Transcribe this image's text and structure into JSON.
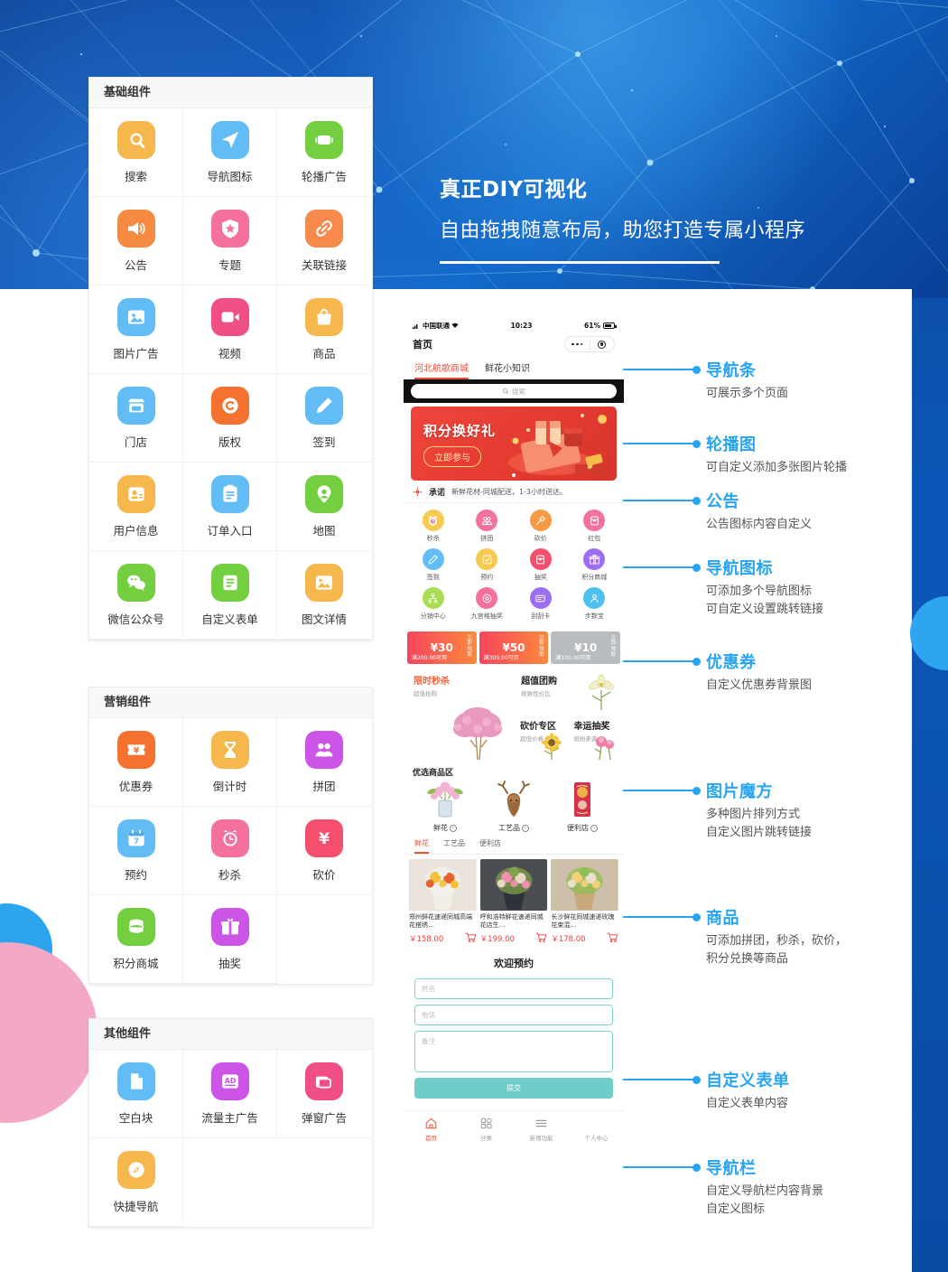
{
  "headline": {
    "line1": "真正DIY可视化",
    "line2": "自由拖拽随意布局，助您打造专属小程序"
  },
  "panels": [
    {
      "title": "基础组件",
      "items": [
        {
          "label": "搜索",
          "icon": "search-icon",
          "color": "#f6b74d"
        },
        {
          "label": "导航图标",
          "icon": "navigation-paper-plane-icon",
          "color": "#63bdf5"
        },
        {
          "label": "轮播广告",
          "icon": "carousel-icon",
          "color": "#73cf3f"
        },
        {
          "label": "公告",
          "icon": "megaphone-icon",
          "color": "#f58a41"
        },
        {
          "label": "专题",
          "icon": "star-badge-icon",
          "color": "#f4709d"
        },
        {
          "label": "关联链接",
          "icon": "link-icon",
          "color": "#f58a4c"
        },
        {
          "label": "图片广告",
          "icon": "image-icon",
          "color": "#63bdf5"
        },
        {
          "label": "视频",
          "icon": "video-camera-icon",
          "color": "#f04f85"
        },
        {
          "label": "商品",
          "icon": "shopping-bag-icon",
          "color": "#f6b74d"
        },
        {
          "label": "门店",
          "icon": "storefront-icon",
          "color": "#63bdf5"
        },
        {
          "label": "版权",
          "icon": "copyright-icon",
          "color": "#f5712f"
        },
        {
          "label": "签到",
          "icon": "pencil-icon",
          "color": "#63bdf5"
        },
        {
          "label": "用户信息",
          "icon": "user-card-icon",
          "color": "#f6b74d"
        },
        {
          "label": "订单入口",
          "icon": "clipboard-icon",
          "color": "#63bdf5"
        },
        {
          "label": "地图",
          "icon": "map-pin-icon",
          "color": "#73cf3f"
        },
        {
          "label": "微信公众号",
          "icon": "wechat-icon",
          "color": "#73cf3f"
        },
        {
          "label": "自定义表单",
          "icon": "form-lines-icon",
          "color": "#73cf3f"
        },
        {
          "label": "图文详情",
          "icon": "article-image-icon",
          "color": "#f6b74d"
        }
      ]
    },
    {
      "title": "营销组件",
      "items": [
        {
          "label": "优惠券",
          "icon": "coupon-icon",
          "color": "#f5712f"
        },
        {
          "label": "倒计时",
          "icon": "hourglass-icon",
          "color": "#f6b74d"
        },
        {
          "label": "拼团",
          "icon": "group-people-icon",
          "color": "#cc55e8"
        },
        {
          "label": "预约",
          "icon": "calendar-icon",
          "color": "#63bdf5"
        },
        {
          "label": "秒杀",
          "icon": "alarm-clock-icon",
          "color": "#f4709d"
        },
        {
          "label": "砍价",
          "icon": "yuan-sign-icon",
          "color": "#f4506e"
        },
        {
          "label": "积分商城",
          "icon": "coins-stack-icon",
          "color": "#73cf3f"
        },
        {
          "label": "抽奖",
          "icon": "gift-icon",
          "color": "#cc55e8"
        }
      ]
    },
    {
      "title": "其他组件",
      "items": [
        {
          "label": "空白块",
          "icon": "blank-page-icon",
          "color": "#63bdf5"
        },
        {
          "label": "流量主广告",
          "icon": "ad-icon",
          "color": "#cc55e8"
        },
        {
          "label": "弹窗广告",
          "icon": "popup-window-icon",
          "color": "#f04f85"
        },
        {
          "label": "快捷导航",
          "icon": "compass-icon",
          "color": "#f6b74d"
        }
      ]
    }
  ],
  "phone": {
    "status": {
      "carrier": "中国联通",
      "time": "10:23",
      "battery": "61%"
    },
    "title": "首页",
    "nav_tabs": [
      {
        "label": "河北航歌商城",
        "active": true
      },
      {
        "label": "鲜花小知识",
        "active": false
      }
    ],
    "search_placeholder": "搜索",
    "banner": {
      "title": "积分换好礼",
      "button": "立即参与"
    },
    "notice": {
      "label": "承诺",
      "text": "新鲜花材-同城配送，1-3小时送达。"
    },
    "nav_icons": [
      {
        "label": "秒杀",
        "icon": "alarm-clock-icon",
        "color": "#f7c94f"
      },
      {
        "label": "拼团",
        "icon": "group-people-icon",
        "color": "#f4709d"
      },
      {
        "label": "砍价",
        "icon": "axe-icon",
        "color": "#f79a45"
      },
      {
        "label": "红包",
        "icon": "red-packet-icon",
        "color": "#f4709d"
      },
      {
        "label": "签到",
        "icon": "pencil-icon",
        "color": "#63bdf5"
      },
      {
        "label": "预约",
        "icon": "check-box-icon",
        "color": "#f7c94f"
      },
      {
        "label": "抽奖",
        "icon": "red-packet-icon",
        "color": "#f4506e"
      },
      {
        "label": "积分商城",
        "icon": "gift-icon",
        "color": "#9d6ef0"
      },
      {
        "label": "分销中心",
        "icon": "share-tree-icon",
        "color": "#a9dd56"
      },
      {
        "label": "九宫格抽奖",
        "icon": "donut-icon",
        "color": "#f4709d"
      },
      {
        "label": "刮刮卡",
        "icon": "scratch-card-icon",
        "color": "#9d6ef0"
      },
      {
        "label": "步数宝",
        "icon": "person-icon",
        "color": "#4fc0ef"
      }
    ],
    "coupons": [
      {
        "amount": "¥30",
        "condition": "满200.00可用",
        "action": "立即领取",
        "gray": false
      },
      {
        "amount": "¥50",
        "condition": "满300.00可用",
        "action": "立即领取",
        "gray": false
      },
      {
        "amount": "¥10",
        "condition": "满100.00可用",
        "action": "立即领取",
        "gray": true
      }
    ],
    "cube": [
      {
        "title": "限时秒杀",
        "subtitle": "超值抢购",
        "hot": true
      },
      {
        "title": "超值团购",
        "subtitle": "极致性价比",
        "hot": false
      },
      {
        "title": "砍价专区",
        "subtitle": "超低价格",
        "hot": false
      },
      {
        "title": "幸运抽奖",
        "subtitle": "缤纷来袭",
        "hot": false
      }
    ],
    "picks_title": "优选商品区",
    "picks": [
      {
        "label": "鲜花"
      },
      {
        "label": "工艺品"
      },
      {
        "label": "便利店"
      }
    ],
    "cat_tabs": [
      {
        "label": "鲜花",
        "active": true
      },
      {
        "label": "工艺品",
        "active": false
      },
      {
        "label": "便利店",
        "active": false
      }
    ],
    "products": [
      {
        "name": "郑州鲜花速递同城高端花搭绣…",
        "price": "￥158.00"
      },
      {
        "name": "呼和浩特鲜花速递同城花店生…",
        "price": "￥199.00"
      },
      {
        "name": "长沙鲜花同城速递玫瑰花束混…",
        "price": "￥178.00"
      }
    ],
    "form": {
      "title": "欢迎预约",
      "name_placeholder": "姓名",
      "phone_placeholder": "电话",
      "remark_placeholder": "备注",
      "submit": "提交"
    },
    "tabbar": [
      {
        "label": "首页",
        "icon": "home-icon",
        "active": true
      },
      {
        "label": "分类",
        "icon": "grid-icon",
        "active": false
      },
      {
        "label": "新增功能",
        "icon": "menu-lines-icon",
        "active": false
      },
      {
        "label": "个人中心",
        "icon": "person-icon",
        "active": false
      }
    ]
  },
  "annotations": [
    {
      "title": "导航条",
      "desc": [
        "可展示多个页面"
      ]
    },
    {
      "title": "轮播图",
      "desc": [
        "可自定义添加多张图片轮播"
      ]
    },
    {
      "title": "公告",
      "desc": [
        "公告图标内容自定义"
      ]
    },
    {
      "title": "导航图标",
      "desc": [
        "可添加多个导航图标",
        "可自定义设置跳转链接"
      ]
    },
    {
      "title": "优惠券",
      "desc": [
        "自定义优惠券背景图"
      ]
    },
    {
      "title": "图片魔方",
      "desc": [
        "多种图片排列方式",
        "自定义图片跳转链接"
      ]
    },
    {
      "title": "商品",
      "desc": [
        "可添加拼团，秒杀，砍价，",
        "积分兑换等商品"
      ]
    },
    {
      "title": "自定义表单",
      "desc": [
        "自定义表单内容"
      ]
    },
    {
      "title": "导航栏",
      "desc": [
        "自定义导航栏内容背景",
        "自定义图标"
      ]
    }
  ],
  "colors": {
    "accent_blue": "#27a4f2",
    "brand_red": "#e8503a",
    "form_teal": "#6ecdc8",
    "deco_pink": "#f4a8c8"
  }
}
